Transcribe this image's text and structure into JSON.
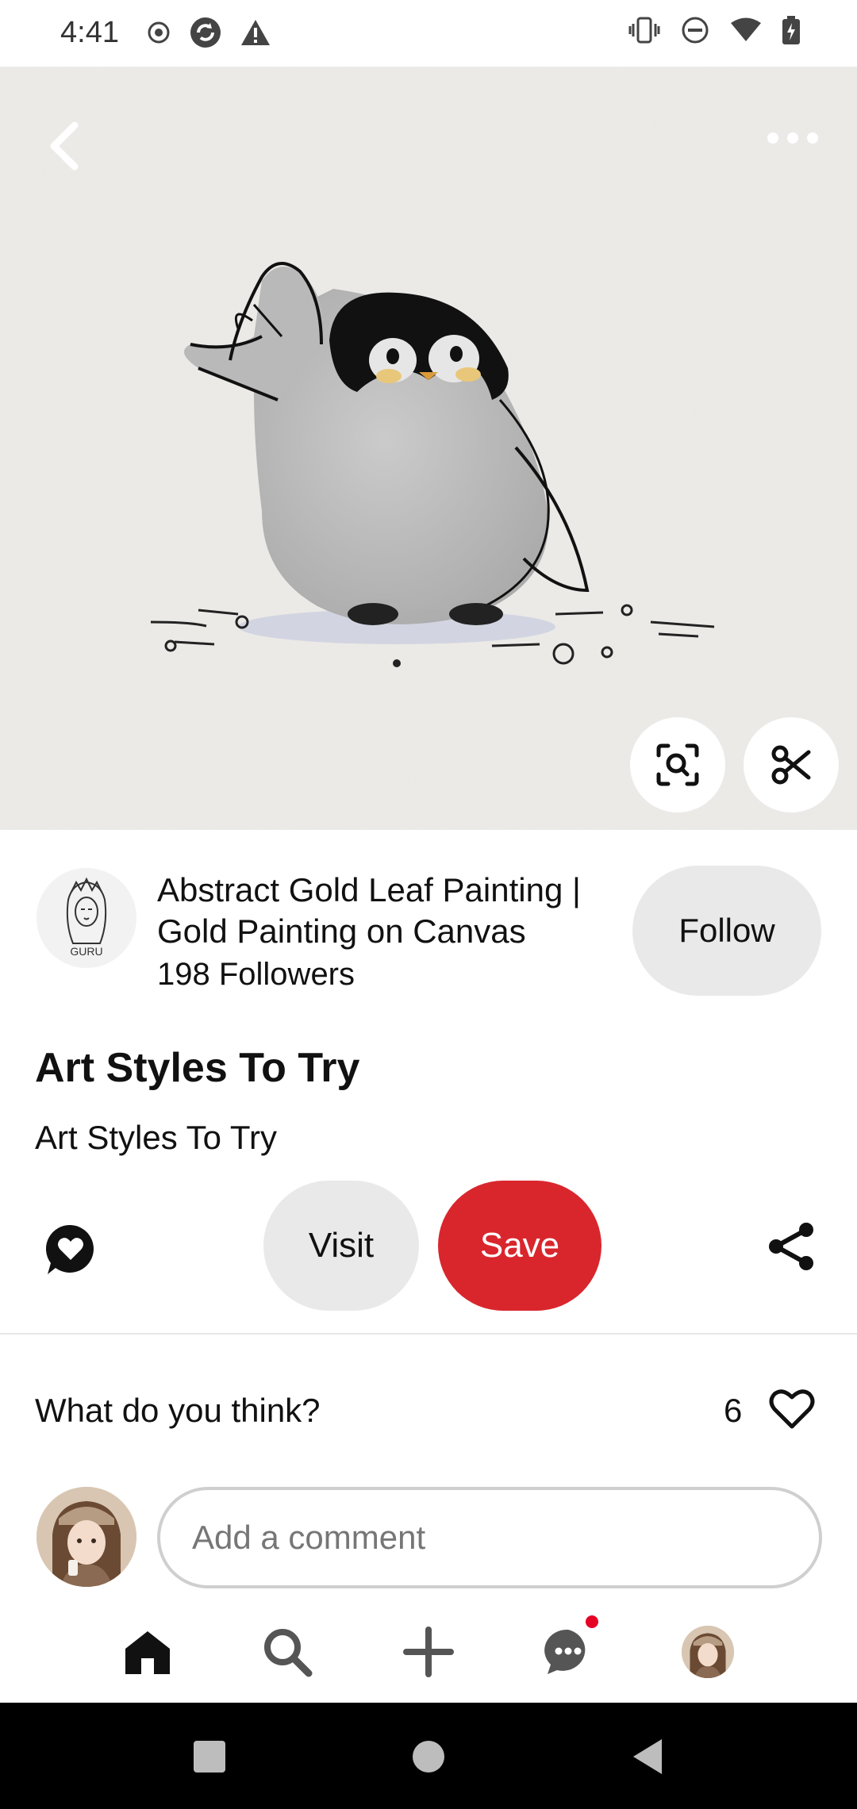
{
  "status_bar": {
    "time": "4:41"
  },
  "pin": {
    "creator": {
      "name": "Abstract Gold Leaf Painting | Gold Painting on Canvas",
      "followers": "198 Followers",
      "avatar_text": "GURU"
    },
    "follow_label": "Follow",
    "title": "Art Styles To Try",
    "description": "Art Styles To Try"
  },
  "actions": {
    "visit_label": "Visit",
    "save_label": "Save"
  },
  "comments": {
    "prompt": "What do you think?",
    "likes_count": "6",
    "placeholder": "Add a comment"
  },
  "colors": {
    "save_red": "#d9262d",
    "notification_red": "#e60023",
    "pill_gray": "#e9e9e9"
  },
  "icons": {
    "back": "chevron-left-icon",
    "more": "more-horizontal-icon",
    "visual_search": "lens-icon",
    "cutout": "scissors-icon",
    "comment_react": "heart-bubble-icon",
    "share": "share-icon",
    "like": "heart-outline-icon",
    "nav": [
      "home-icon",
      "search-icon",
      "plus-icon",
      "chat-icon",
      "profile-avatar"
    ]
  }
}
